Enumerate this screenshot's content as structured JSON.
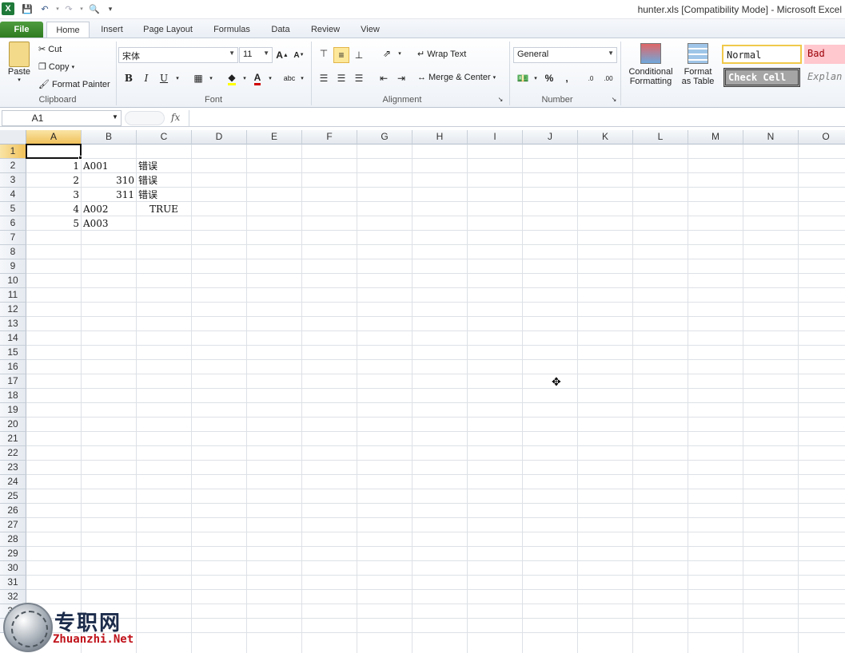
{
  "window": {
    "title": "hunter.xls  [Compatibility Mode]  -  Microsoft Excel"
  },
  "tabs": [
    {
      "label": "File"
    },
    {
      "label": "Home"
    },
    {
      "label": "Insert"
    },
    {
      "label": "Page Layout"
    },
    {
      "label": "Formulas"
    },
    {
      "label": "Data"
    },
    {
      "label": "Review"
    },
    {
      "label": "View"
    }
  ],
  "ribbon": {
    "clipboard": {
      "paste": "Paste",
      "cut": "Cut",
      "copy": "Copy",
      "format_painter": "Format Painter",
      "label": "Clipboard"
    },
    "font": {
      "name": "宋体",
      "size": "11",
      "bold": "B",
      "italic": "I",
      "underline": "U",
      "label": "Font"
    },
    "alignment": {
      "wrap_text": "Wrap Text",
      "merge_center": "Merge & Center",
      "label": "Alignment"
    },
    "number": {
      "format": "General",
      "percent": "%",
      "comma": ",",
      "label": "Number"
    },
    "styles": {
      "conditional_formatting_1": "Conditional",
      "conditional_formatting_2": "Formatting",
      "format_as_table_1": "Format",
      "format_as_table_2": "as Table",
      "normal": "Normal",
      "bad": "Bad",
      "check_cell": "Check Cell",
      "explanatory": "Explan"
    },
    "colors": {
      "font_color": "#d00000",
      "highlight": "#ffff00",
      "bad_bg": "#ffc7ce",
      "bad_fg": "#9c0006"
    }
  },
  "formula_bar": {
    "name_box": "A1",
    "fx": "fx",
    "content": ""
  },
  "sheet": {
    "columns": [
      "A",
      "B",
      "C",
      "D",
      "E",
      "F",
      "G",
      "H",
      "I",
      "J",
      "K",
      "L",
      "M",
      "N",
      "O"
    ],
    "rows": [
      "1",
      "2",
      "3",
      "4",
      "5",
      "6",
      "7",
      "8",
      "9",
      "10",
      "11",
      "12",
      "13",
      "14",
      "15",
      "16",
      "17",
      "18",
      "19",
      "20",
      "21",
      "22",
      "23",
      "24",
      "25",
      "26",
      "27",
      "28",
      "29",
      "30",
      "31",
      "32",
      "33",
      "34"
    ],
    "cells": {
      "A2": "1",
      "B2": "A001",
      "C2": "错误",
      "A3": "2",
      "B3": "310",
      "C3": "错误",
      "A4": "3",
      "B4": "311",
      "C4": "错误",
      "A5": "4",
      "B5": "A002",
      "C5": "TRUE",
      "A6": "5",
      "B6": "A003"
    },
    "selected_cell": "A1"
  },
  "watermark": {
    "cn": "专职网",
    "en": "Zhuanzhi.Net"
  }
}
